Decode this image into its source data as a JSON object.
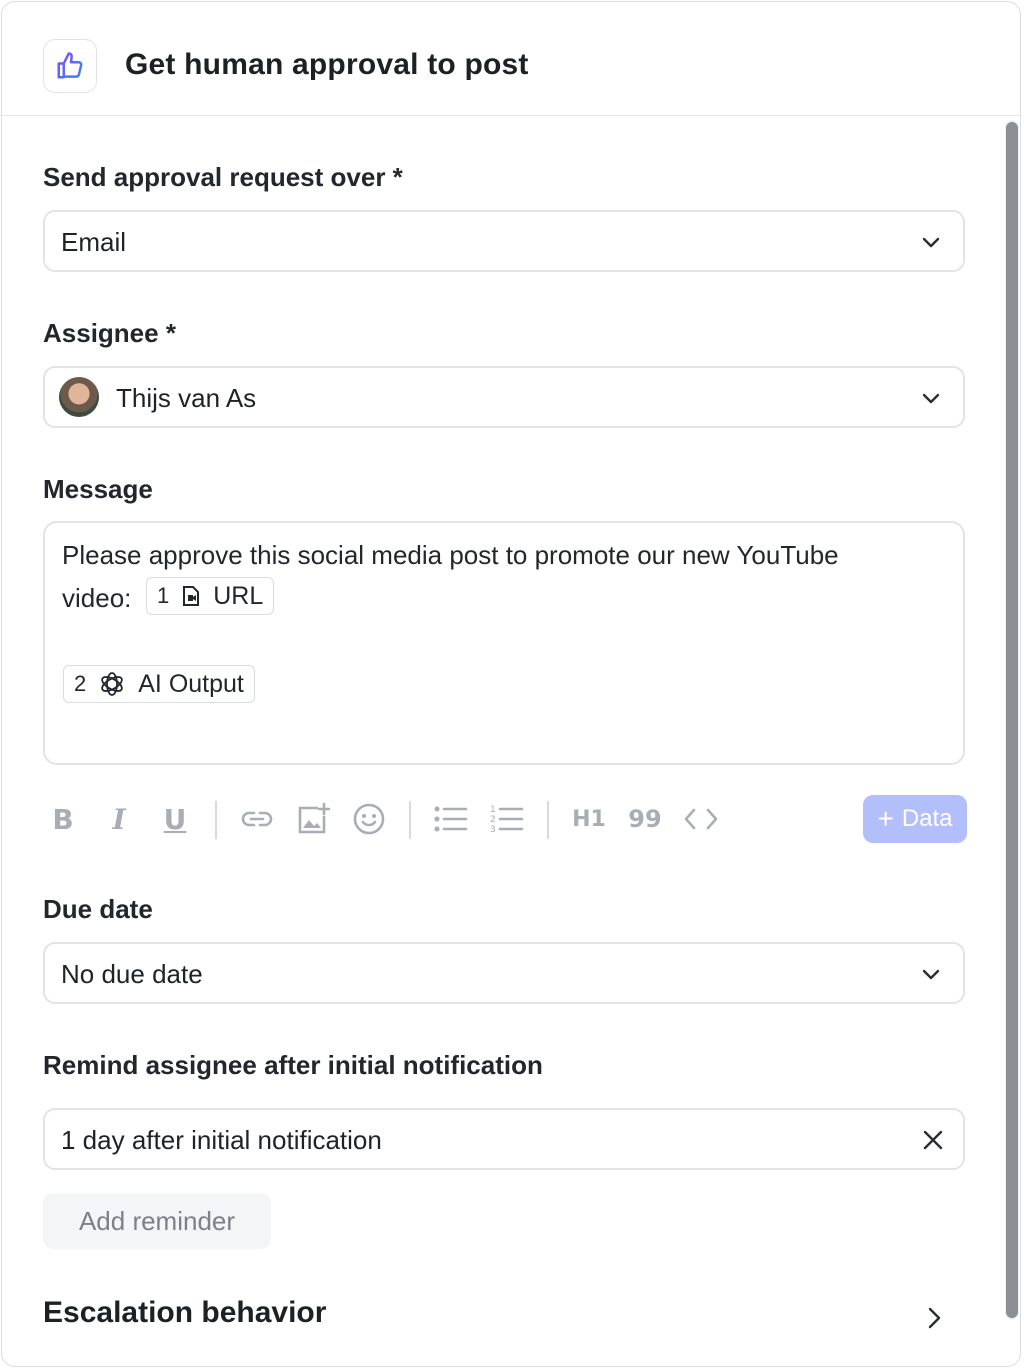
{
  "header": {
    "title": "Get human approval to post",
    "icon": "thumbs-up-icon"
  },
  "channel": {
    "label": "Send approval request over *",
    "value": "Email"
  },
  "assignee": {
    "label": "Assignee *",
    "value": "Thijs van As"
  },
  "message": {
    "label": "Message",
    "line1": "Please approve this social media post to promote our new YouTube",
    "line2_prefix": "video:",
    "chips": [
      {
        "num": "1",
        "icon": "file-video-icon",
        "label": "URL"
      },
      {
        "num": "2",
        "icon": "openai-icon",
        "label": "AI Output"
      }
    ]
  },
  "toolbar": {
    "h1": "H1",
    "quote": "99",
    "data_button": "Data",
    "data_plus": "+"
  },
  "due_date": {
    "label": "Due date",
    "value": "No due date"
  },
  "reminder": {
    "label": "Remind assignee after initial notification",
    "value": "1 day after initial notification",
    "add_label": "Add reminder"
  },
  "escalation": {
    "label": "Escalation behavior"
  },
  "colors": {
    "accent": "#5b5ef0",
    "data_button_bg": "#b3bffb",
    "scroll_thumb": "#8c8f93"
  }
}
